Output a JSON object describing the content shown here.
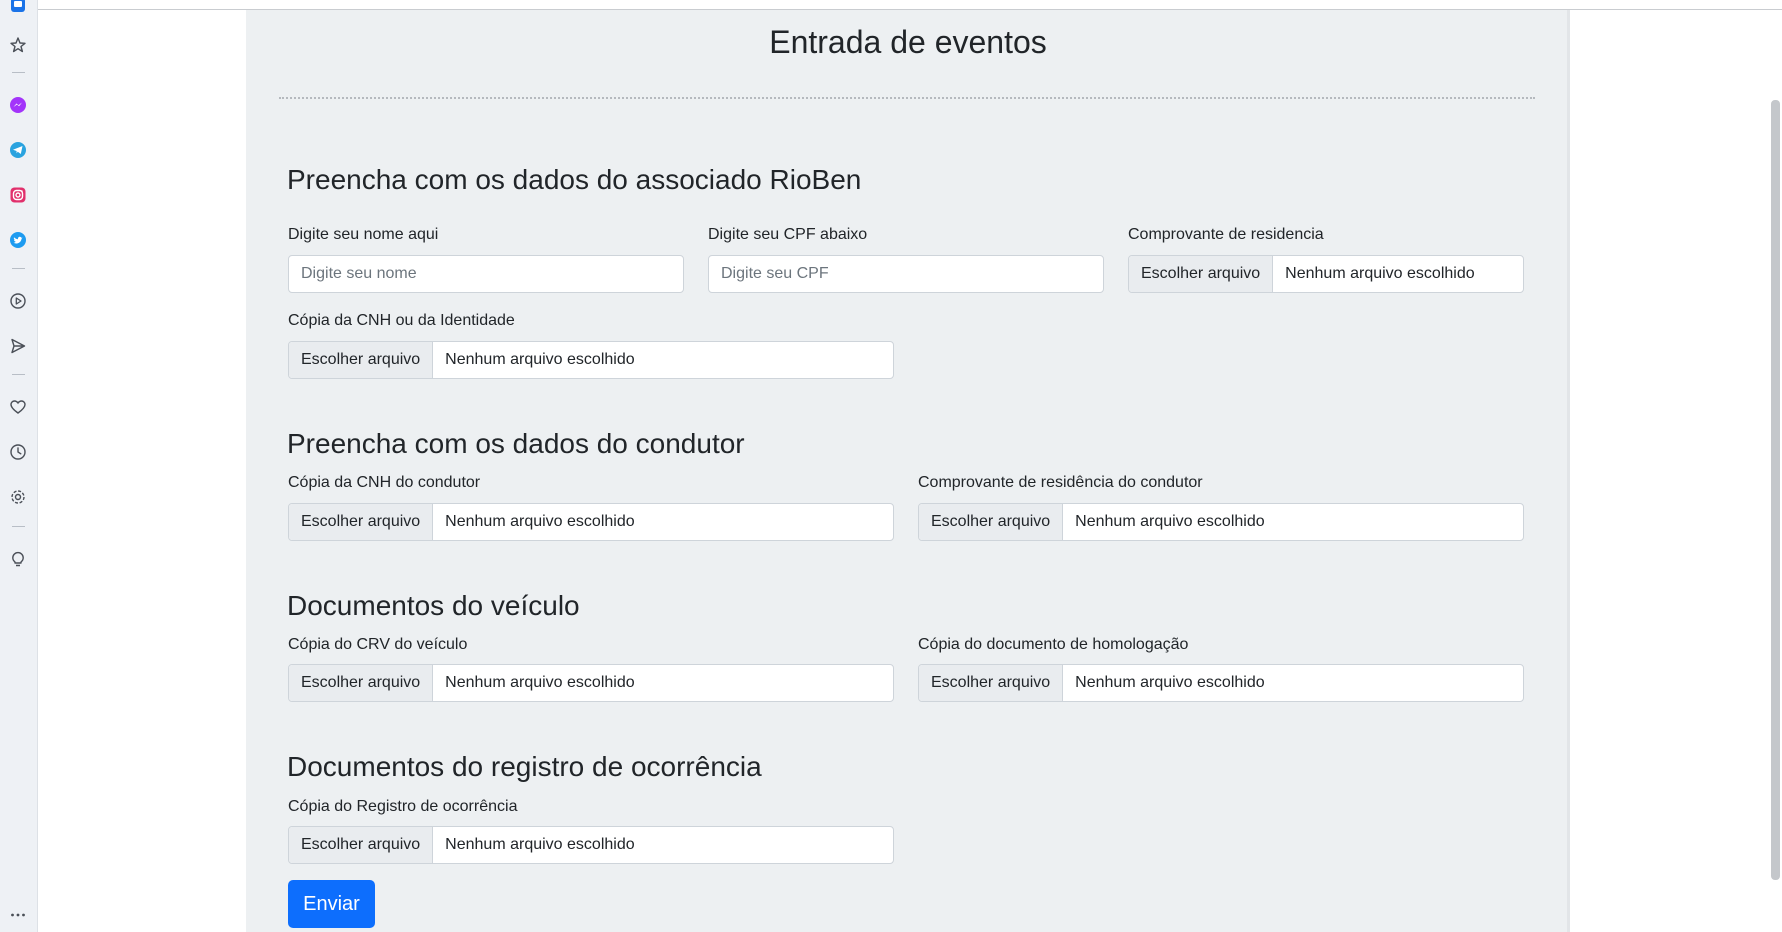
{
  "page": {
    "title": "Entrada de eventos",
    "submit_label": "Enviar"
  },
  "file_defaults": {
    "button_label": "Escolher arquivo",
    "status": "Nenhum arquivo escolhido"
  },
  "associado": {
    "title": "Preencha com os dados do associado RioBen",
    "name_label": "Digite seu nome aqui",
    "name_placeholder": "Digite seu nome",
    "name_value": "",
    "cpf_label": "Digite seu CPF abaixo",
    "cpf_placeholder": "Digite seu CPF",
    "cpf_value": "",
    "residencia_label": "Comprovante de residencia",
    "cnh_label": "Cópia da CNH ou da Identidade"
  },
  "condutor": {
    "title": "Preencha com os dados do condutor",
    "cnh_label": "Cópia da CNH do condutor",
    "residencia_label": "Comprovante de residência do condutor"
  },
  "veiculo": {
    "title": "Documentos do veículo",
    "crv_label": "Cópia do CRV do veículo",
    "homologacao_label": "Cópia do documento de homologação"
  },
  "ocorrencia": {
    "title": "Documentos do registro de ocorrência",
    "registro_label": "Cópia do Registro de ocorrência"
  },
  "sidebar": {
    "icons": [
      "workspaces-icon",
      "bookmarks-icon",
      "messenger-icon",
      "telegram-icon",
      "instagram-icon",
      "twitter-icon",
      "player-icon",
      "send-icon",
      "heart-icon",
      "history-icon",
      "settings-icon",
      "tips-icon",
      "more-icon"
    ]
  },
  "colors": {
    "primary": "#0d6efd",
    "panel": "#edf0f2",
    "messenger": "#a334fa",
    "telegram": "#2aa3df",
    "instagram": "#e1306c",
    "twitter": "#1d9bf0"
  }
}
